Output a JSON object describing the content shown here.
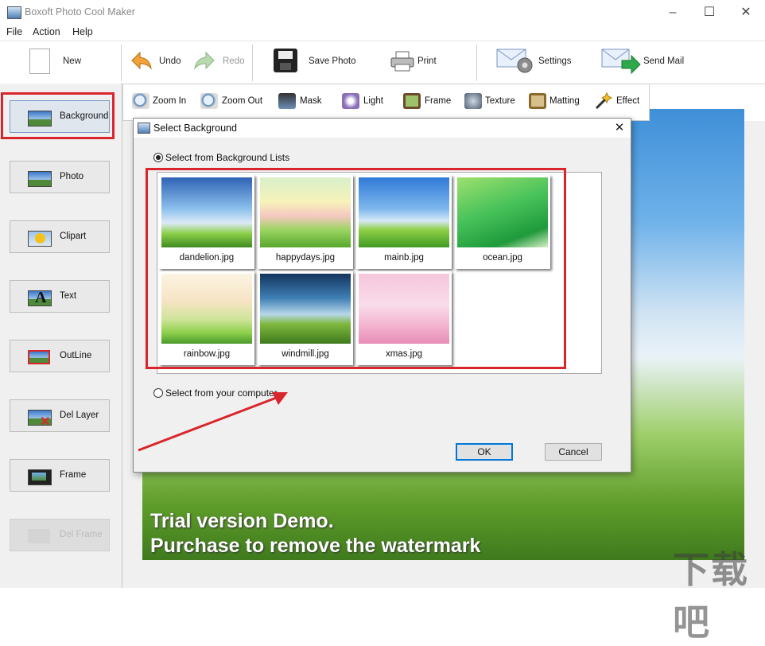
{
  "window": {
    "title": "Boxoft Photo Cool Maker",
    "controls": [
      "–",
      "☐",
      "✕"
    ]
  },
  "menu": [
    "File",
    "Action",
    "Help"
  ],
  "toolbar": {
    "new": "New",
    "undo": "Undo",
    "redo": "Redo",
    "save_photo": "Save Photo",
    "print": "Print",
    "settings": "Settings",
    "send_mail": "Send Mail"
  },
  "sidebar": {
    "items": [
      {
        "label": "Background",
        "icon": "background-icon",
        "selected": true
      },
      {
        "label": "Photo",
        "icon": "photo-icon"
      },
      {
        "label": "Clipart",
        "icon": "clipart-icon"
      },
      {
        "label": "Text",
        "icon": "text-icon"
      },
      {
        "label": "OutLine",
        "icon": "outline-icon"
      },
      {
        "label": "Del Layer",
        "icon": "del-layer-icon"
      },
      {
        "label": "Frame",
        "icon": "frame-icon"
      },
      {
        "label": "Del Frame",
        "icon": "del-frame-icon",
        "disabled": true
      }
    ]
  },
  "subtoolbar": [
    "Zoom In",
    "Zoom Out",
    "Mask",
    "Light",
    "Frame",
    "Texture",
    "Matting",
    "Effect"
  ],
  "dialog": {
    "title": "Select Background",
    "option_lists": "Select from Background Lists",
    "option_computer": "Select from your computer",
    "backgrounds": [
      "dandelion.jpg",
      "happydays.jpg",
      "mainb.jpg",
      "ocean.jpg",
      "rainbow.jpg",
      "windmill.jpg",
      "xmas.jpg"
    ],
    "ok": "OK",
    "cancel": "Cancel"
  },
  "canvas": {
    "watermark_line1": "Trial version Demo.",
    "watermark_line2": "Purchase to remove the watermark"
  },
  "colors": {
    "highlight": "#d9262c",
    "accent": "#0078d7"
  }
}
